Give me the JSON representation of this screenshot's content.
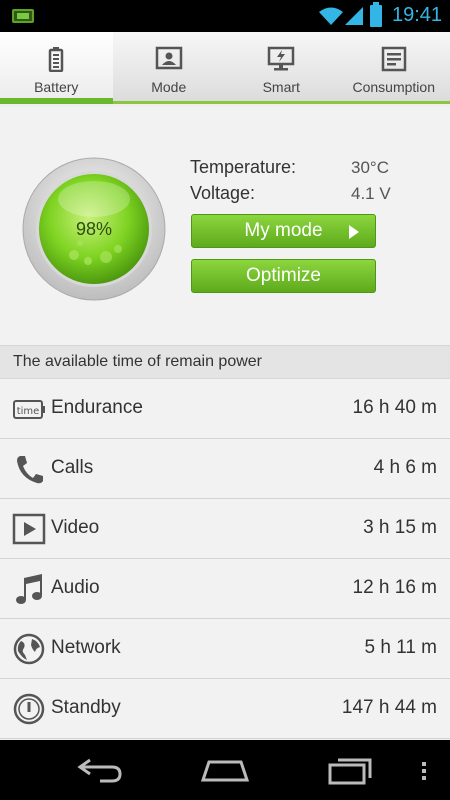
{
  "status_bar": {
    "time": "19:41",
    "icons": [
      "battery-indicator-icon",
      "wifi-icon",
      "signal-icon",
      "battery-icon"
    ]
  },
  "tabs": [
    {
      "label": "Battery",
      "icon": "battery-icon",
      "active": true
    },
    {
      "label": "Mode",
      "icon": "mode-icon",
      "active": false
    },
    {
      "label": "Smart",
      "icon": "smart-icon",
      "active": false
    },
    {
      "label": "Consumption",
      "icon": "consumption-icon",
      "active": false
    }
  ],
  "summary": {
    "percent": "98%",
    "temperature_label": "Temperature:",
    "temperature_value": "30°C",
    "voltage_label": "Voltage:",
    "voltage_value": "4.1 V",
    "my_mode_button": "My mode",
    "optimize_button": "Optimize"
  },
  "section_header": "The available time of remain power",
  "rows": [
    {
      "label": "Endurance",
      "value": "16 h 40 m",
      "icon": "time-icon",
      "icon_text": "time"
    },
    {
      "label": "Calls",
      "value": "4 h 6 m",
      "icon": "phone-icon"
    },
    {
      "label": "Video",
      "value": "3 h 15 m",
      "icon": "video-icon"
    },
    {
      "label": "Audio",
      "value": "12 h 16 m",
      "icon": "music-note-icon"
    },
    {
      "label": "Network",
      "value": "5 h 11 m",
      "icon": "globe-icon"
    },
    {
      "label": "Standby",
      "value": "147 h 44 m",
      "icon": "standby-icon"
    }
  ],
  "colors": {
    "accent_green": "#6ab82c",
    "status_blue": "#33b5e5"
  },
  "navigation": [
    "back-icon",
    "home-icon",
    "recent-apps-icon",
    "menu-icon"
  ]
}
